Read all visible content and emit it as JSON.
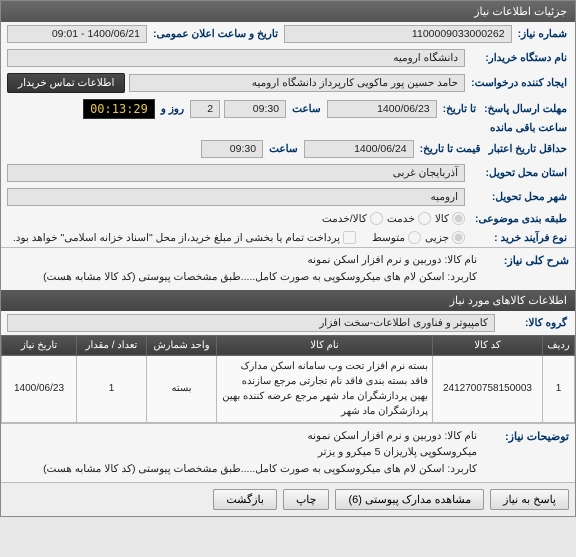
{
  "header": {
    "title": "جزئیات اطلاعات نیاز"
  },
  "fields": {
    "need_no_label": "شماره نیاز:",
    "need_no": "1100009033000262",
    "announce_label": "تاریخ و ساعت اعلان عمومی:",
    "announce": "1400/06/21 - 09:01",
    "org_label": "نام دستگاه خریدار:",
    "org": "دانشگاه ارومیه",
    "requester_label": "ایجاد کننده درخواست:",
    "requester": "حامد حسین پور ماکویی کارپرداز دانشگاه ارومیه",
    "contact_btn": "اطلاعات تماس خریدار",
    "deadline_label": "مهلت ارسال پاسخ:",
    "until_label": "تا تاریخ:",
    "deadline_date": "1400/06/23",
    "time_label": "ساعت",
    "deadline_time": "09:30",
    "day_label": "روز و",
    "days": "2",
    "timer": "00:13:29",
    "remaining": "ساعت باقی مانده",
    "credit_label": "حداقل تاریخ اعتبار",
    "credit_until": "قیمت تا تاریخ:",
    "credit_date": "1400/06/24",
    "credit_time": "09:30",
    "province_label": "استان محل تحویل:",
    "province": "آذربایجان غربی",
    "city_label": "شهر محل تحویل:",
    "city": "ارومیه",
    "subject_cat_label": "طبقه بندی موضوعی:",
    "cat_goods": "کالا",
    "cat_service": "خدمت",
    "cat_both": "کالا/خدمت",
    "process_label": "نوع فرآیند خرید :",
    "process_low": "جزیی",
    "process_med": "متوسط",
    "payment_note": "پرداخت تمام یا بخشی از مبلغ خرید،از محل \"اسناد خزانه اسلامی\" خواهد بود."
  },
  "need_desc": {
    "label": "شرح کلی نیاز:",
    "line1": "نام کالا: دوربین و نرم افزار اسکن نمونه",
    "line2": "کاربرد: اسکن لام های میکروسکوپی به صورت کامل.....طبق مشخصات پیوستی (کد کالا مشابه هست)"
  },
  "items_header": "اطلاعات کالاهای مورد نیاز",
  "group_label": "گروه کالا:",
  "group_value": "کامپیوتر و فناوری اطلاعات-سخت افزار",
  "table": {
    "cols": {
      "row": "ردیف",
      "code": "کد کالا",
      "name": "نام کالا",
      "unit": "واحد شمارش",
      "qty": "تعداد / مقدار",
      "date": "تاریخ نیاز"
    },
    "rows": [
      {
        "row": "1",
        "code": "2412700758150003",
        "name": "بسته نرم افزار تحت وب سامانه اسکن مدارک فاقد بسته بندی فاقد نام تجارتی مرجع سازنده بهین پردازشگران ماد شهر مرجع عرضه کننده بهین پردازشگران ماد شهر",
        "unit": "بسته",
        "qty": "1",
        "date": "1400/06/23"
      }
    ]
  },
  "need_notes": {
    "label": "توضیحات نیاز:",
    "line1": "نام کالا: دوربین و نرم افزار اسکن نمونه",
    "line2": "میکروسکوپی پلاریزان 5 میکرو و یزتر",
    "line3": "کاربرد: اسکن لام های میکروسکوپی به صورت کامل.....طبق مشخصات پیوستی (کد کالا مشابه هست)"
  },
  "footer": {
    "reply": "پاسخ به نیاز",
    "docs": "مشاهده مدارک پیوستی (6)",
    "print": "چاپ",
    "back": "بازگشت"
  }
}
